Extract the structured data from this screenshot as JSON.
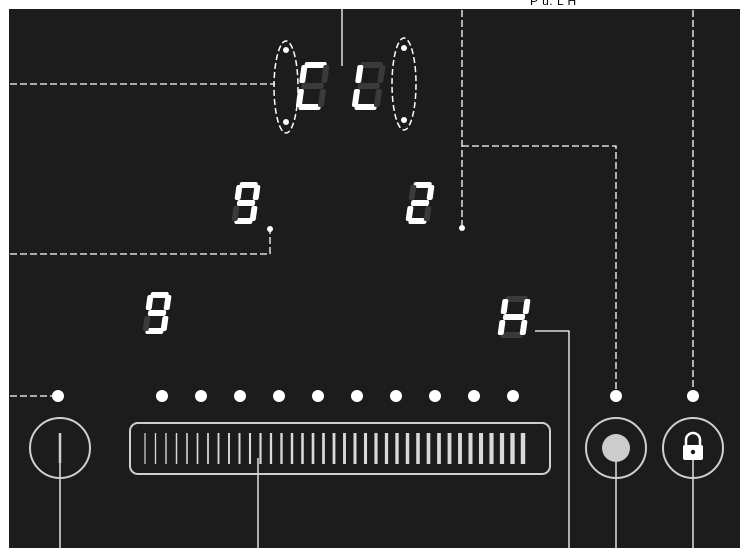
{
  "panel": {
    "colors": {
      "background": "#1c1c1c",
      "segment_on": "#ffffff",
      "segment_off": "#3a3a3a",
      "guide": "#ffffff"
    },
    "top_display": {
      "text": "CL"
    },
    "zone_left_top": {
      "text": "9"
    },
    "zone_right_top": {
      "text": "2"
    },
    "zone_left_bottom": {
      "text": "9"
    },
    "zone_right_bottom": {
      "text": "H"
    },
    "callout_top_right": {
      "text": "P u. L H"
    },
    "power_level_dots": {
      "count": 10
    },
    "slider_control": {
      "tick_count": 37,
      "icon": "slider-ticks-icon"
    },
    "power_button": {
      "icon": "power-icon"
    },
    "pause_button": {
      "icon": "stop-circle-icon"
    },
    "lock_button": {
      "icon": "lock-icon"
    }
  }
}
